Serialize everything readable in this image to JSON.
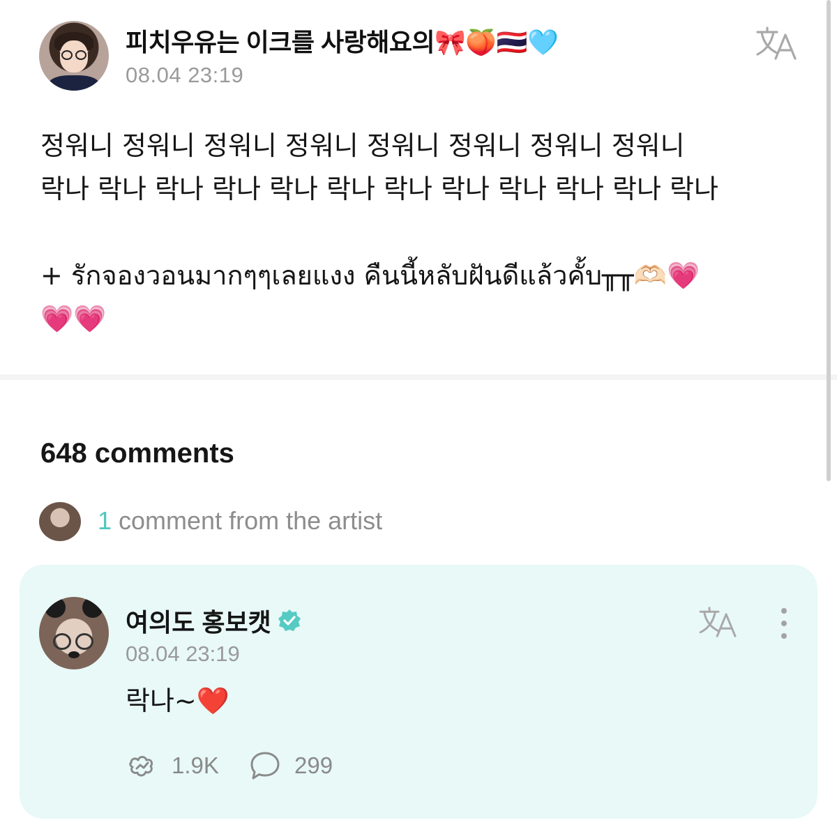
{
  "post": {
    "author": "피치우유는 이크를 사랑해요의🎀🍑🇹🇭🩵",
    "timestamp": "08.04 23:19",
    "body": "정워니 정워니 정워니 정워니 정워니 정워니 정워니 정워니\n락나 락나 락나 락나 락나 락나 락나 락나 락나 락나 락나 락나\n\n+ รักจองวอนมากๆๆเลยแงง คืนนี้หลับฝันดีแล้วคั้บ╥╥🫶🏻💗\n💗💗",
    "icons": [
      "translate-icon"
    ]
  },
  "comments": {
    "count_label": "648 comments",
    "artist_summary": {
      "count": "1",
      "label": "comment from the artist"
    }
  },
  "artist_comment": {
    "author": "여의도 홍보캣",
    "verified": true,
    "timestamp": "08.04 23:19",
    "text": "락나~❤️",
    "likes": "1.9K",
    "replies": "299",
    "icons": [
      "translate-icon",
      "more-vertical-icon",
      "like-icon",
      "reply-icon",
      "verified-badge-icon"
    ]
  },
  "colors": {
    "accent": "#4fc7bf",
    "card_background": "#e8f9f7",
    "muted_text": "#9a9a9a"
  }
}
